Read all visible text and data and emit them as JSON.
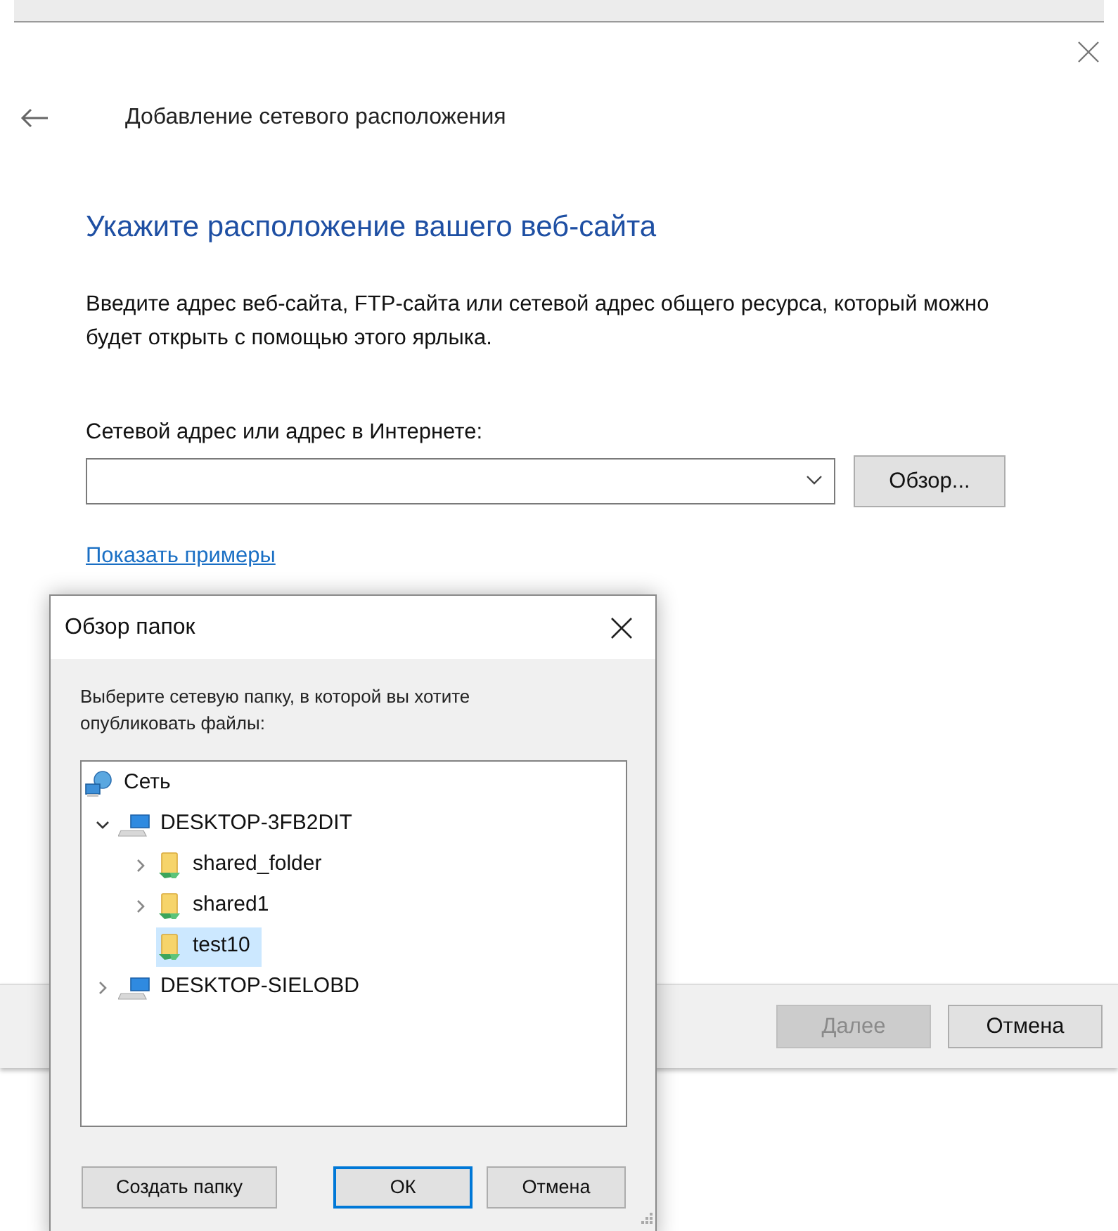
{
  "wizard": {
    "title": "Добавление сетевого расположения",
    "heading": "Укажите расположение вашего веб-сайта",
    "description": "Введите адрес веб-сайта, FTP-сайта или сетевой адрес общего ресурса, который можно будет открыть с помощью этого ярлыка.",
    "address_label": "Сетевой адрес или адрес в Интернете:",
    "browse_button": "Обзор...",
    "examples_link": "Показать примеры",
    "buttons": [
      {
        "label": "Далее",
        "disabled": true
      },
      {
        "label": "Отмена",
        "disabled": false
      }
    ]
  },
  "browse_dialog": {
    "title": "Обзор папок",
    "prompt": "Выберите сетевую папку, в которой вы хотите опубликовать файлы:",
    "tree": [
      {
        "label": "Сеть",
        "kind": "network",
        "selected": false,
        "children": [
          {
            "label": "DESKTOP-3FB2DIT",
            "kind": "computer",
            "expanded": true,
            "selected": false,
            "children": [
              {
                "label": "shared_folder",
                "kind": "share",
                "expanded": false,
                "selected": false
              },
              {
                "label": "shared1",
                "kind": "share",
                "expanded": false,
                "selected": false
              },
              {
                "label": "test10",
                "kind": "share",
                "selected": true
              }
            ]
          },
          {
            "label": "DESKTOP-SIELOBD",
            "kind": "computer",
            "expanded": false,
            "selected": false
          }
        ]
      }
    ],
    "buttons": [
      {
        "label": "Создать папку",
        "default": false
      },
      {
        "label": "ОК",
        "default": true
      },
      {
        "label": "Отмена",
        "default": false
      }
    ]
  }
}
